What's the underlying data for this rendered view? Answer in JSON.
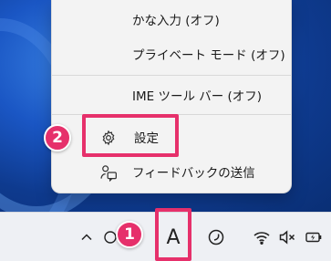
{
  "menu": {
    "items": [
      {
        "label": "かな入力 (オフ)"
      },
      {
        "label": "プライベート モード (オフ)"
      },
      {
        "label": "IME ツール バー (オフ)"
      },
      {
        "label": "設定",
        "icon": "gear-icon"
      },
      {
        "label": "フィードバックの送信",
        "icon": "feedback-icon"
      }
    ]
  },
  "annotations": {
    "badge_1": "1",
    "badge_2": "2",
    "highlight_color": "#e6306b"
  },
  "taskbar": {
    "ime_mode": "A",
    "tray_icons": [
      "chevron-up-icon",
      "ime-toggle-icon",
      "ime-mode-icon",
      "ime-pad-icon",
      "wifi-icon",
      "volume-muted-icon",
      "battery-charging-icon"
    ]
  }
}
